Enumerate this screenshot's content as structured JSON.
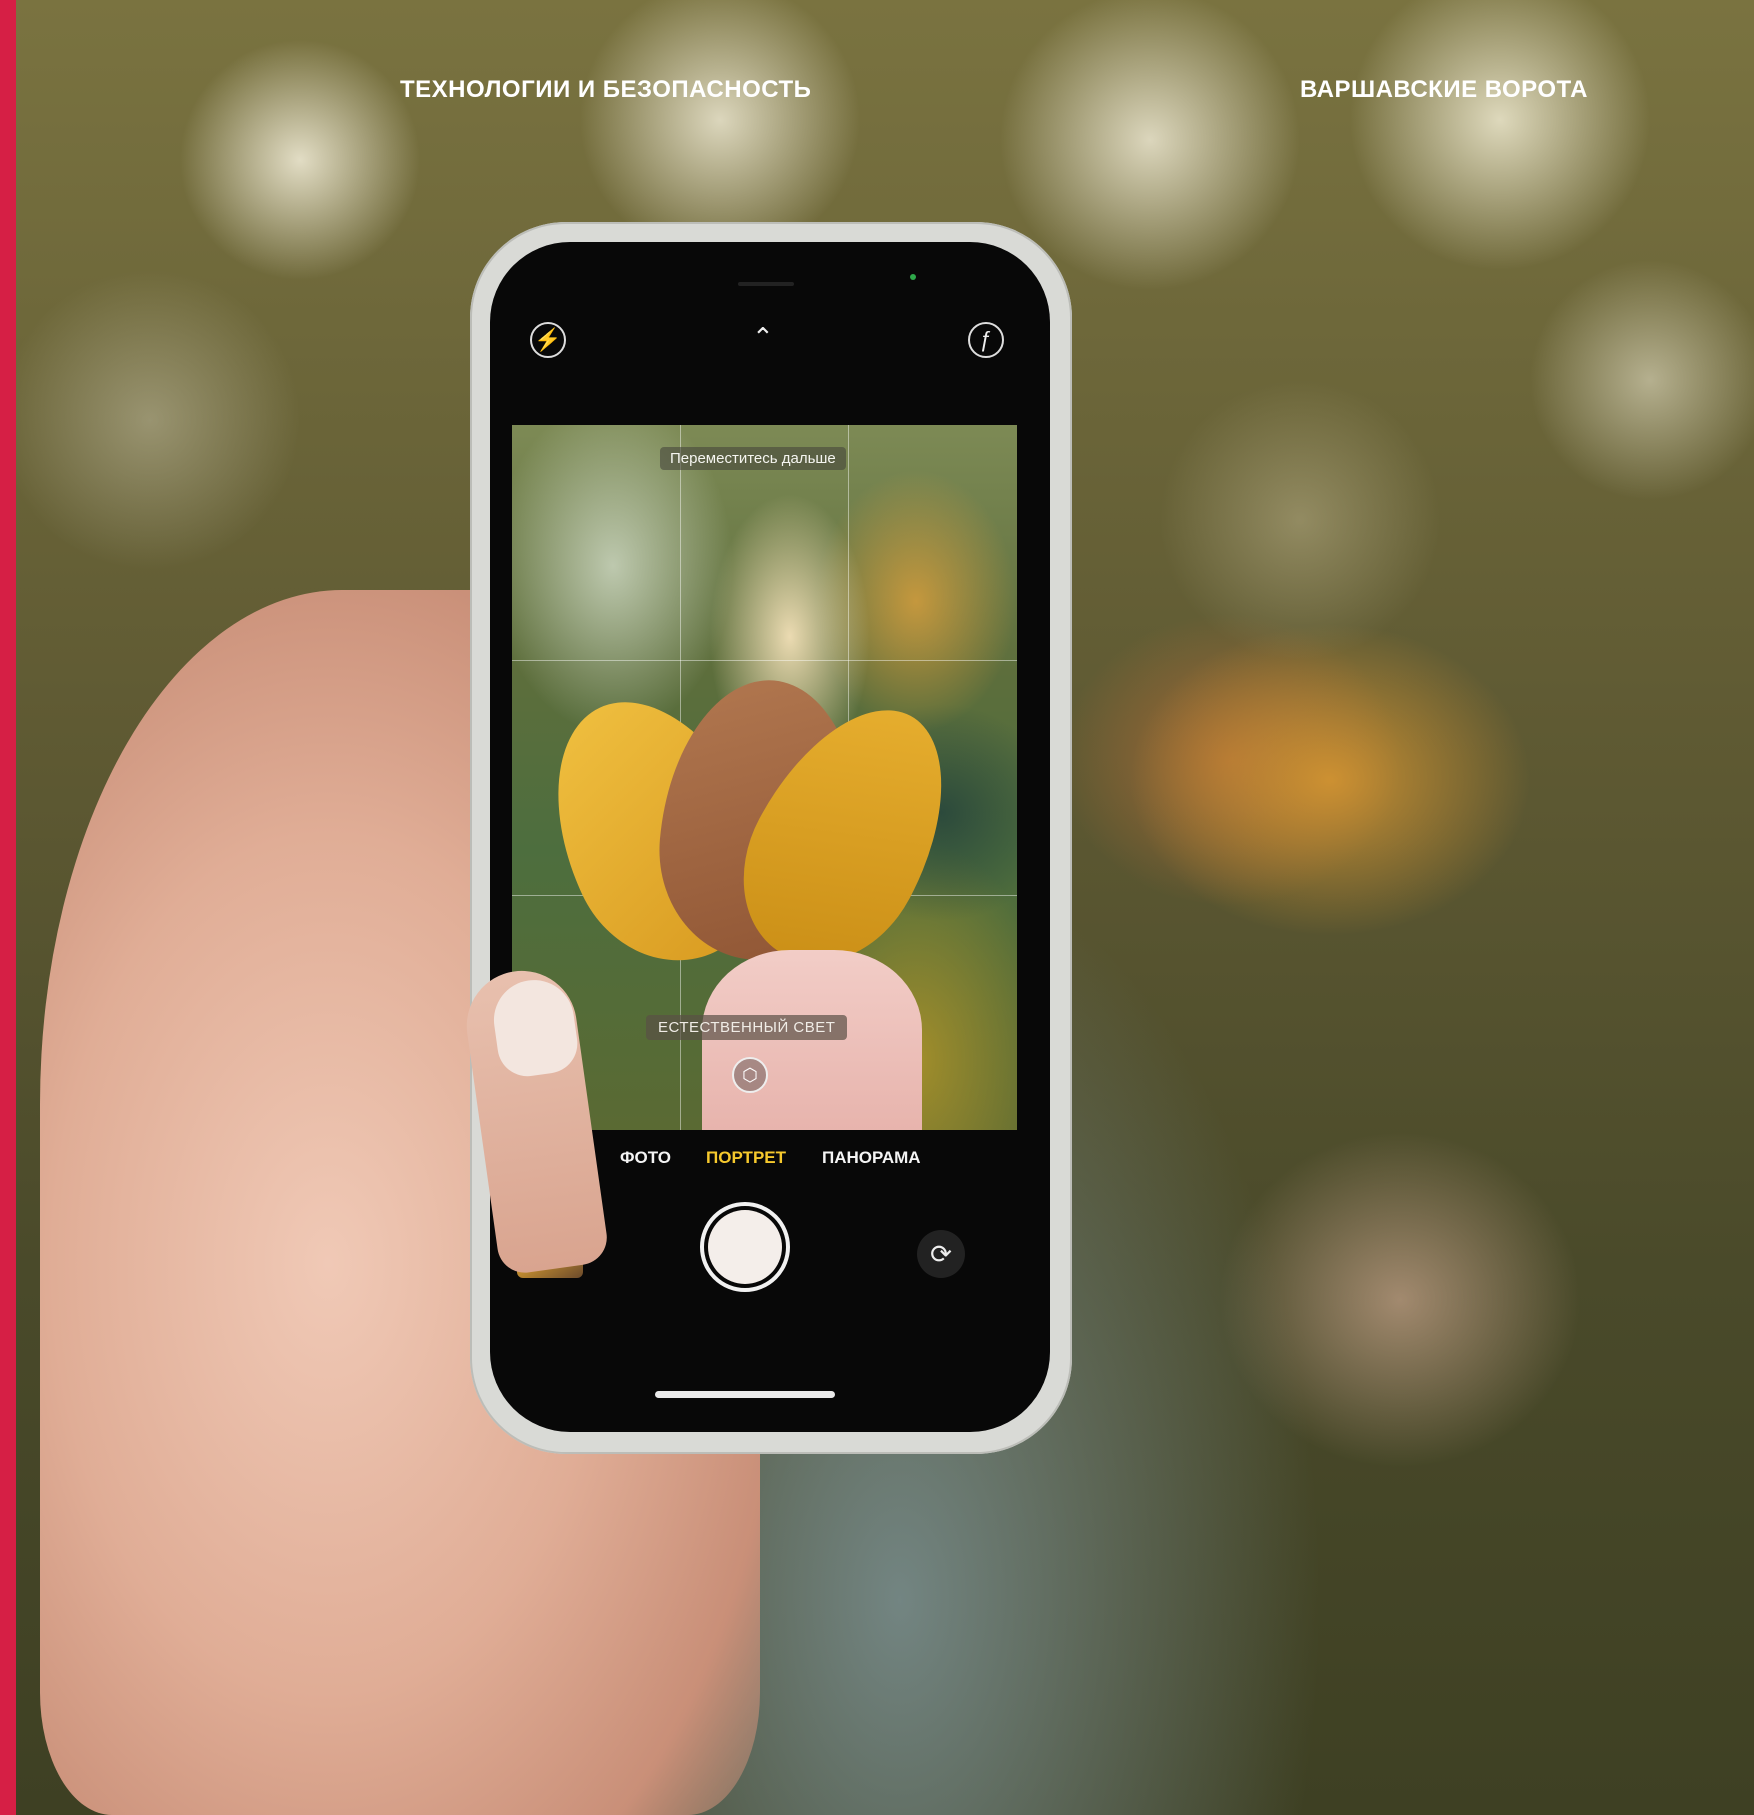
{
  "header": {
    "section_label": "ТЕХНОЛОГИИ И БЕЗОПАСНОСТЬ",
    "location_label": "ВАРШАВСКИЕ ВОРОТА"
  },
  "camera_app": {
    "hint_text": "Переместитесь дальше",
    "lighting_label": "ЕСТЕСТВЕННЫЙ СВЕТ",
    "modes": [
      "ФОТО",
      "ПОРТРЕТ",
      "ПАНОРАМА"
    ],
    "active_mode": "ПОРТРЕТ",
    "icons": {
      "flash_off": "flash-off-icon",
      "expand": "chevron-up-icon",
      "live": "live-photo-icon",
      "lighting": "portrait-lighting-icon",
      "flip": "camera-flip-icon"
    }
  },
  "colors": {
    "accent_bar": "#d61f45",
    "active_mode": "#f6c92d"
  }
}
